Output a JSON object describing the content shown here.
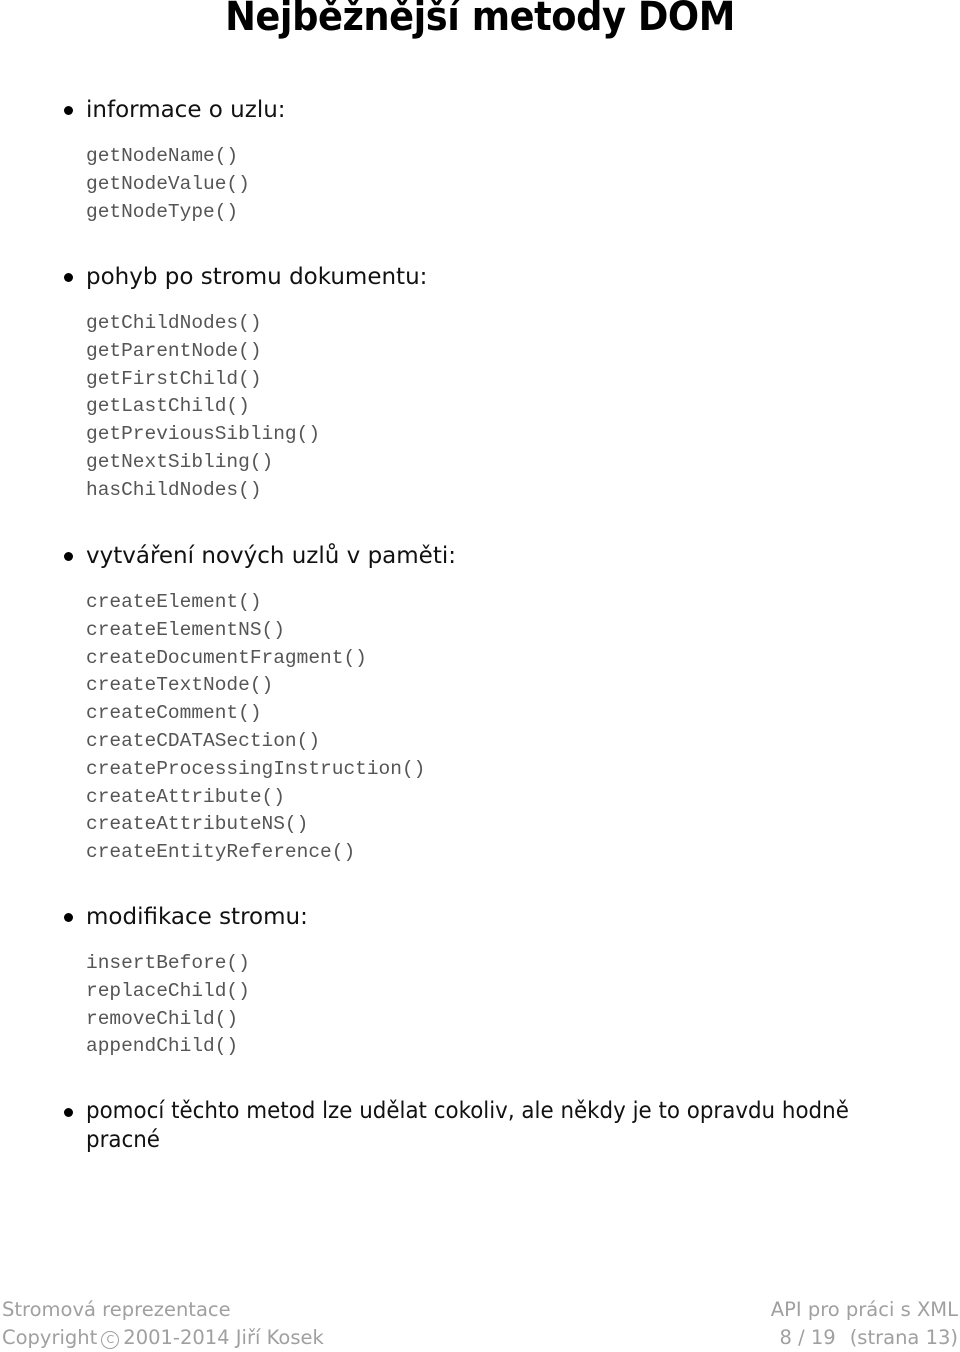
{
  "slide": {
    "title": "Nejběžnější metody DOM",
    "sections": [
      {
        "heading": "informace o uzlu:",
        "methods": [
          "getNodeName()",
          "getNodeValue()",
          "getNodeType()"
        ]
      },
      {
        "heading": "pohyb po stromu dokumentu:",
        "methods": [
          "getChildNodes()",
          "getParentNode()",
          "getFirstChild()",
          "getLastChild()",
          "getPreviousSibling()",
          "getNextSibling()",
          "hasChildNodes()"
        ]
      },
      {
        "heading": "vytváření nových uzlů v paměti:",
        "methods": [
          "createElement()",
          "createElementNS()",
          "createDocumentFragment()",
          "createTextNode()",
          "createComment()",
          "createCDATASection()",
          "createProcessingInstruction()",
          "createAttribute()",
          "createAttributeNS()",
          "createEntityReference()"
        ]
      },
      {
        "heading": "modifikace stromu:",
        "methods": [
          "insertBefore()",
          "replaceChild()",
          "removeChild()",
          "appendChild()"
        ]
      }
    ],
    "closing_bullet": "pomocí těchto metod lze udělat cokoliv, ale někdy je to opravdu hodně pracné"
  },
  "footer": {
    "section_name": "Stromová reprezentace",
    "copyright_label": "Copyright",
    "copyright_symbol": "C",
    "copyright_text": "2001-2014 Jiří Kosek",
    "chapter_name": "API pro práci s XML",
    "slide_position": "8 / 19",
    "page_label": "(strana 13)"
  }
}
